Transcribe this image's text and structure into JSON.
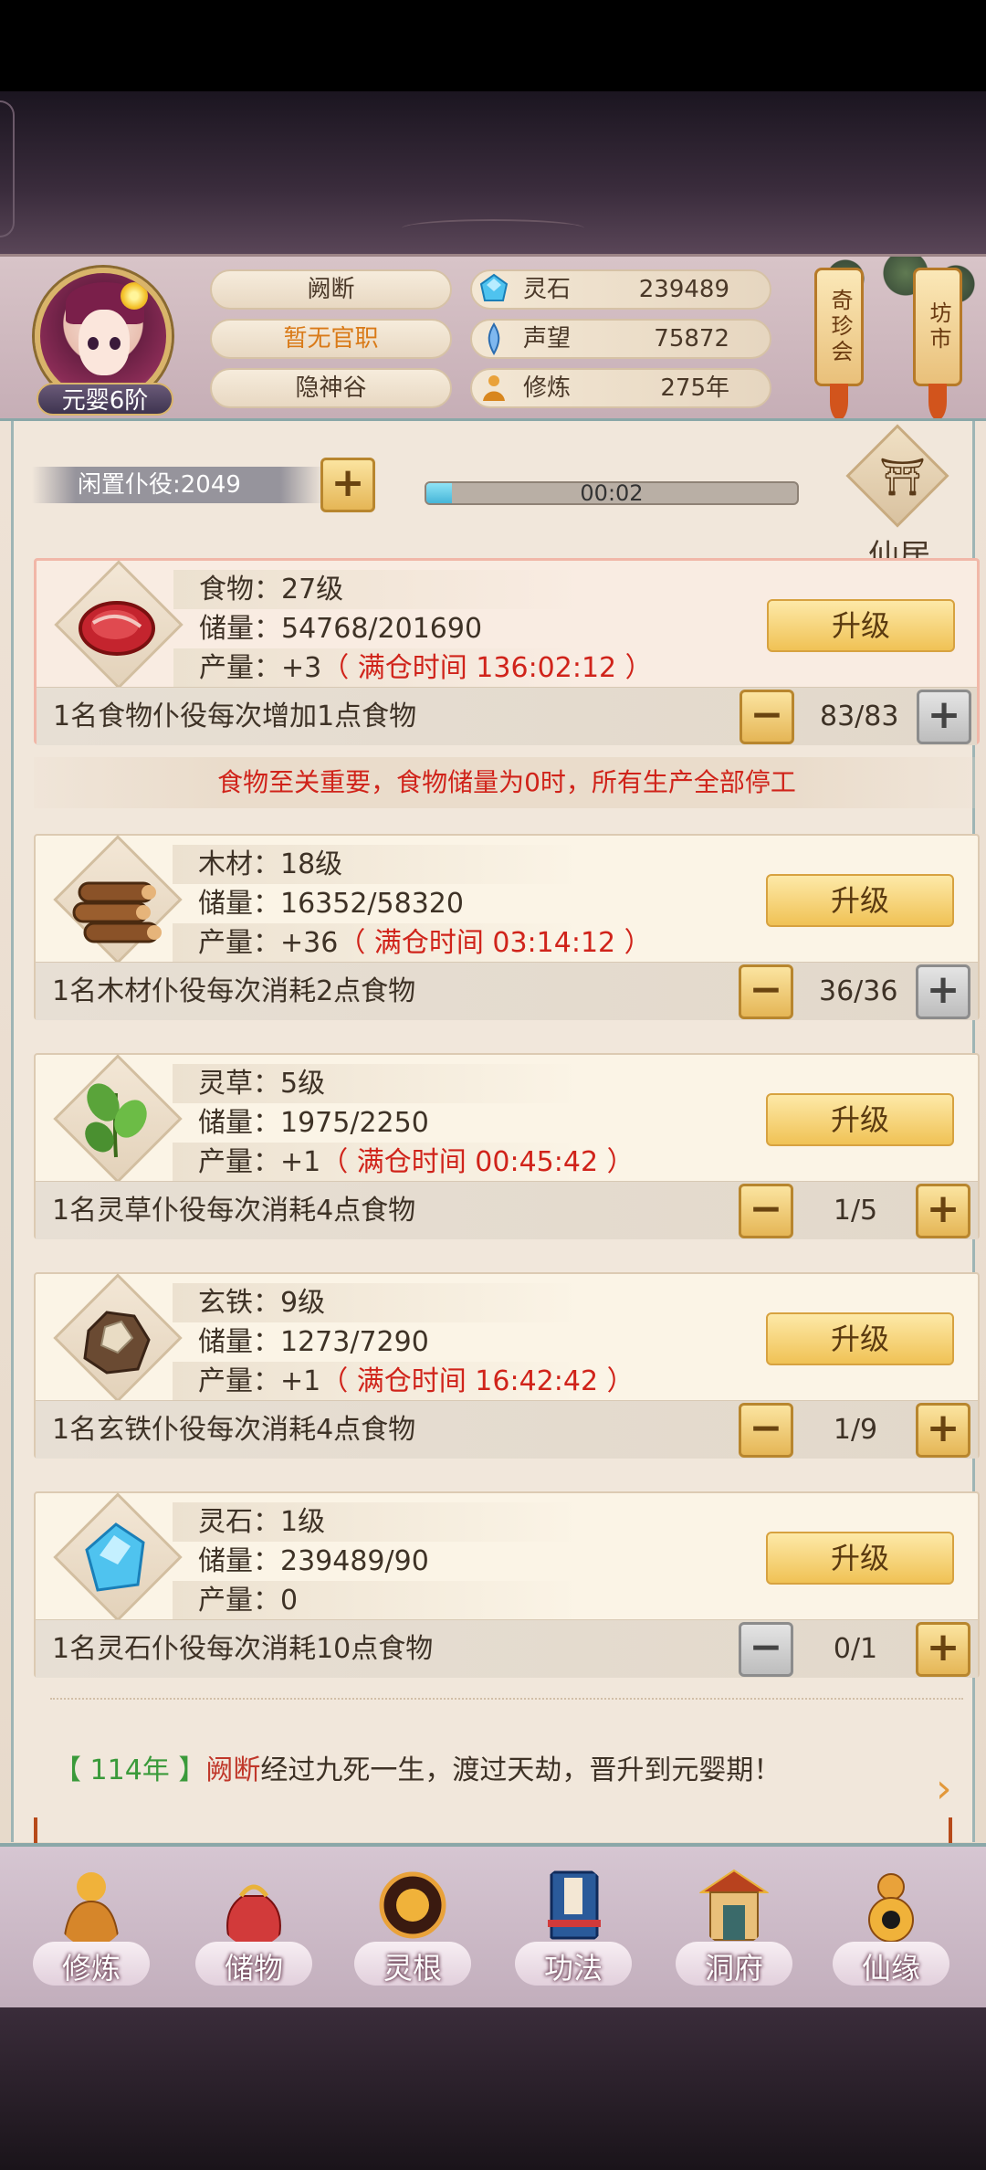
{
  "player": {
    "name": "阙断",
    "official_title": "暂无官职",
    "sect": "隐神谷",
    "rank": "元婴6阶"
  },
  "resources": [
    {
      "icon": "spirit-stone-icon",
      "label": "灵石",
      "value": "239489"
    },
    {
      "icon": "reputation-icon",
      "label": "声望",
      "value": "75872"
    },
    {
      "icon": "cultivation-icon",
      "label": "修炼",
      "value": "275年"
    }
  ],
  "hanging_buttons": {
    "qizhenhui": "奇珍会",
    "fangshi": "坊市"
  },
  "idle": {
    "label": "闲置仆役:2049",
    "timer": "00:02",
    "progress": 0.07
  },
  "xianju_label": "仙居",
  "cards": [
    {
      "name_level": "食物：27级",
      "storage": "储量：54768/201690",
      "output_prefix": "产量：+3",
      "output_time": "（ 满仓时间 136:02:12 ）",
      "upgrade": "升级",
      "desc": "1名食物仆役每次增加1点食物",
      "count": "83/83"
    },
    {
      "name_level": "木材：18级",
      "storage": "储量：16352/58320",
      "output_prefix": "产量：+36",
      "output_time": "（ 满仓时间 03:14:12 ）",
      "upgrade": "升级",
      "desc": "1名木材仆役每次消耗2点食物",
      "count": "36/36"
    },
    {
      "name_level": "灵草：5级",
      "storage": "储量：1975/2250",
      "output_prefix": "产量：+1",
      "output_time": "（ 满仓时间 00:45:42 ）",
      "upgrade": "升级",
      "desc": "1名灵草仆役每次消耗4点食物",
      "count": "1/5"
    },
    {
      "name_level": "玄铁：9级",
      "storage": "储量：1273/7290",
      "output_prefix": "产量：+1",
      "output_time": "（ 满仓时间 16:42:42 ）",
      "upgrade": "升级",
      "desc": "1名玄铁仆役每次消耗4点食物",
      "count": "1/9"
    },
    {
      "name_level": "灵石：1级",
      "storage": "储量：239489/90",
      "output_prefix": "产量：0",
      "output_time": "",
      "upgrade": "升级",
      "desc": "1名灵石仆役每次消耗10点食物",
      "count": "0/1"
    }
  ],
  "warning": "食物至关重要，食物储量为0时，所有生产全部停工",
  "log": {
    "year": "【 114年 】",
    "name": "阙断",
    "text": "经过九死一生，渡过天劫，晋升到元婴期！"
  },
  "nav": [
    {
      "label": "修炼",
      "icon": "cultivate-icon"
    },
    {
      "label": "储物",
      "icon": "storage-bag-icon"
    },
    {
      "label": "灵根",
      "icon": "spirit-root-icon"
    },
    {
      "label": "功法",
      "icon": "technique-book-icon"
    },
    {
      "label": "洞府",
      "icon": "cave-mansion-icon"
    },
    {
      "label": "仙缘",
      "icon": "fortune-gourd-icon"
    }
  ],
  "colors": {
    "accent_gold": "#f0c255",
    "warning_red": "#d0231a",
    "log_green": "#3a9a3a"
  }
}
